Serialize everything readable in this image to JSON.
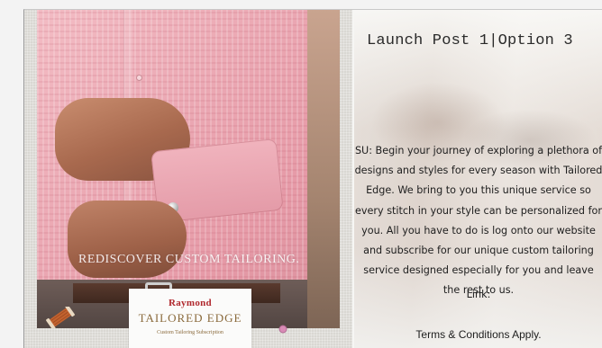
{
  "creative": {
    "tagline": "REDISCOVER CUSTOM TAILORING.",
    "brand": "Raymond",
    "product": "TAILORED EDGE",
    "subtitle": "Custom Tailoring Subscription"
  },
  "post": {
    "title": "Launch Post 1|Option 3",
    "copy": "SU: Begin your journey of exploring a plethora of designs and styles for every season with Tailored Edge. We bring to you this unique service so every stitch in your style can be personalized for you. All you have to do is log onto our website and subscribe for our unique custom tailoring service designed especially for you and leave the rest to us.",
    "link_label": "Link:",
    "terms": "Terms & Conditions Apply."
  },
  "colors": {
    "brand_red": "#b0282d",
    "gold": "#8a6a3c",
    "shirt_pink": "#eba8b3"
  },
  "icons": [
    "thread-spool-icon",
    "pin-icon"
  ]
}
